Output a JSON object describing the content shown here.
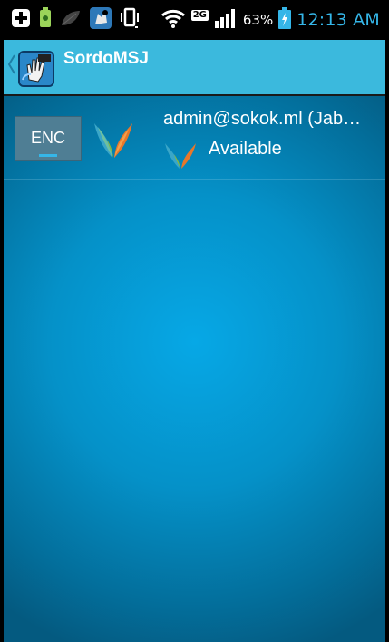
{
  "status_bar": {
    "battery_percent": "63%",
    "clock": "12:13 AM",
    "network_badge": "2G",
    "icons": [
      "medical-cross-icon",
      "usb-debug-icon",
      "leaf-icon",
      "app-notification-icon",
      "vibrate-icon",
      "wifi-icon",
      "network-2g-icon",
      "signal-bars-icon",
      "battery-charging-icon"
    ]
  },
  "action_bar": {
    "title": "SordoMSJ",
    "icon": "app-logo-icon",
    "up_icon": "chevron-left-icon"
  },
  "contact": {
    "enc_label": "ENC",
    "name": "admin@sokok.ml (Jab…",
    "presence": "Available",
    "service_icon": "xmpp-icon",
    "presence_icon": "xmpp-presence-icon"
  },
  "colors": {
    "action_bar": "#3bb9dd",
    "accent": "#35b6e8",
    "content_center": "#06a8e6",
    "content_edge": "#045a80",
    "enc_button": "#4f7e94"
  }
}
